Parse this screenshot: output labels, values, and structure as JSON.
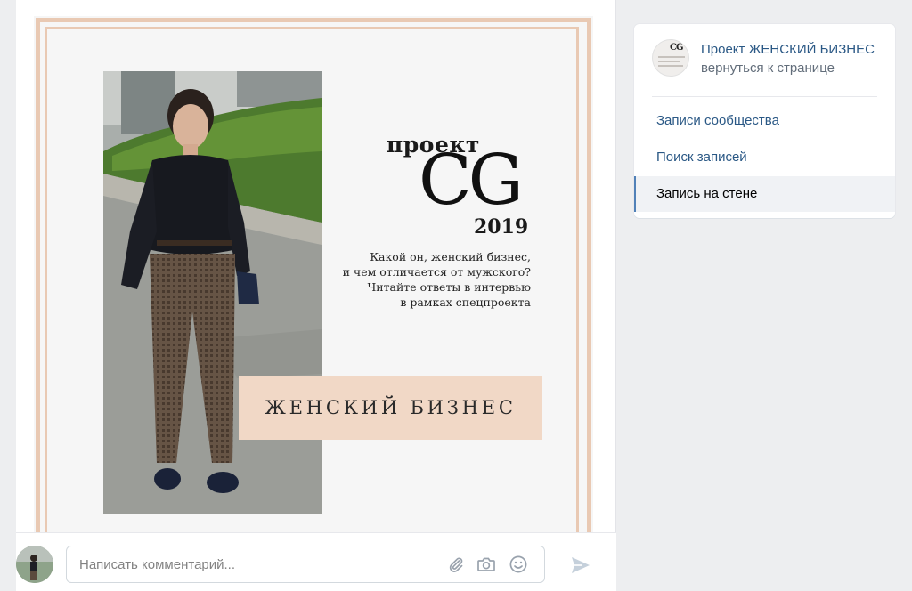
{
  "post": {
    "image": {
      "kicker": "проект",
      "logo": "CG",
      "year": "2019",
      "description_lines": [
        "Какой он, женский бизнес,",
        "и чем отличается от мужского?",
        "Читайте ответы в интервью",
        "в рамках спецпроекта"
      ],
      "badge": "ЖЕНСКИЙ БИЗНЕС"
    },
    "colors": {
      "frame": "#e9c9b3",
      "badge": "#f1d8c6"
    }
  },
  "comment": {
    "placeholder": "Написать комментарий...",
    "icons": [
      "paperclip-icon",
      "camera-icon",
      "smile-icon",
      "send-icon"
    ]
  },
  "sidebar": {
    "community_name": "Проект ЖЕНСКИЙ БИЗНЕС",
    "back_link": "вернуться к странице",
    "menu": [
      {
        "label": "Записи сообщества",
        "active": false
      },
      {
        "label": "Поиск записей",
        "active": false
      },
      {
        "label": "Запись на стене",
        "active": true
      }
    ],
    "colors": {
      "link": "#2a5885",
      "active_marker": "#5181b8"
    }
  }
}
